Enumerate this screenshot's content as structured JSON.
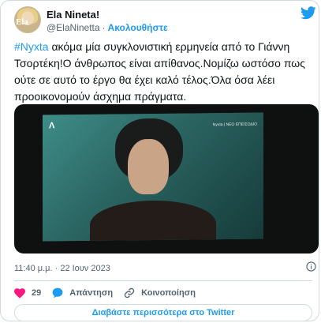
{
  "author": {
    "name": "Ela Nineta!",
    "handle": "@ElaNinetta",
    "separator": "·",
    "follow_label": "Ακολουθήστε",
    "avatar_letters": "Ela"
  },
  "tweet": {
    "hashtag": "#Nyxta",
    "text": " ακόμα μία συγκλονιστική ερμηνεία από το Γιάννη Τσορτέκη!Ο άνθρωπος είναι απίθανος.Νομίζω ωστόσο πως ούτε σε αυτό το έργο θα έχει καλό τέλος.Όλα όσα λέει προοικονομούν άσχημα πράγματα.",
    "timestamp": "11:40 μ.μ. · 22 Ιουν 2023"
  },
  "media": {
    "channel_logo": "Λ",
    "overlay_text": "Nyxta | ΝΕΟ ΕΠΕΙΣΟΔΙΟ"
  },
  "actions": {
    "likes": "29",
    "reply_label": "Απάντηση",
    "share_label": "Κοινοποίηση"
  },
  "read_more": "Διαβάστε περισσότερα στο Twitter",
  "colors": {
    "accent": "#1d9bf0",
    "like": "#f91880",
    "text": "#0f1419",
    "muted": "#536471"
  }
}
